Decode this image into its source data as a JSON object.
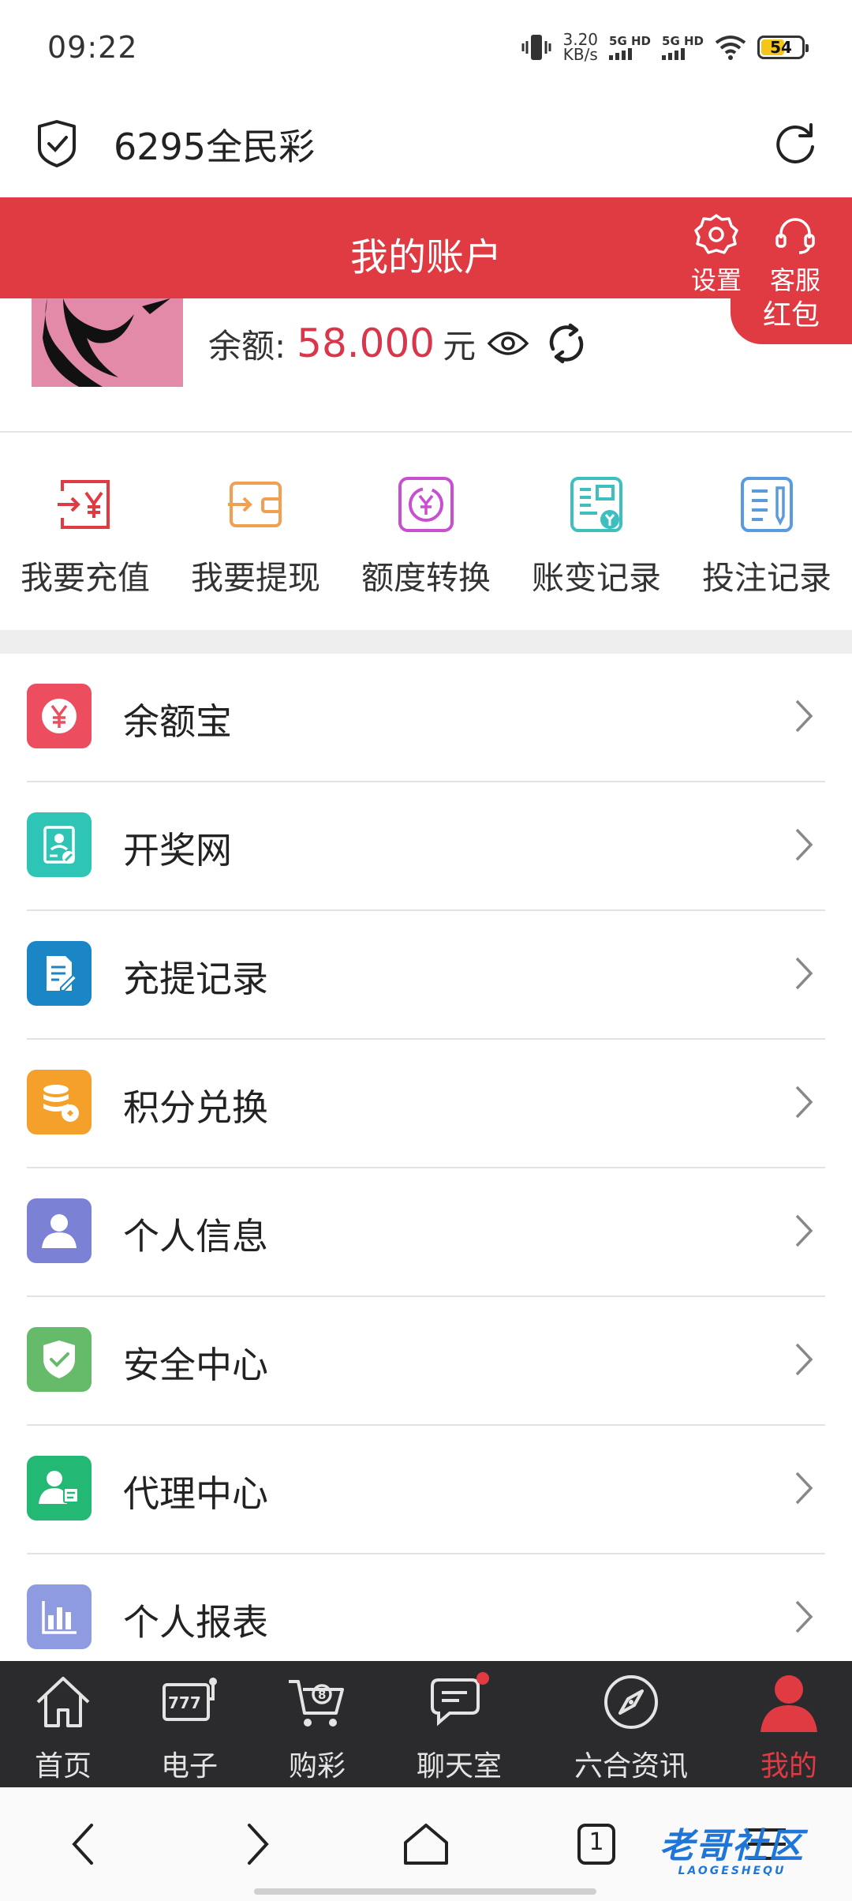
{
  "status_bar": {
    "time": "09:22",
    "net_speed_value": "3.20",
    "net_speed_unit": "KB/s",
    "sim1_label": "5G HD",
    "sim2_label": "5G HD",
    "battery": "54"
  },
  "browser": {
    "site_title": "6295全民彩",
    "left_icon": "shield-check-icon",
    "right_icon": "reload-icon"
  },
  "header": {
    "title": "我的账户",
    "settings_label": "设置",
    "service_label": "客服",
    "red_packet_label": "红包"
  },
  "profile": {
    "balance_label": "余额:",
    "balance_value": "58.000",
    "balance_unit": "元"
  },
  "quick_actions": [
    {
      "label": "我要充值",
      "icon": "recharge-icon",
      "color": "#e03a43"
    },
    {
      "label": "我要提现",
      "icon": "withdraw-icon",
      "color": "#f0a050"
    },
    {
      "label": "额度转换",
      "icon": "transfer-icon",
      "color": "#c84fd0"
    },
    {
      "label": "账变记录",
      "icon": "account-record-icon",
      "color": "#3dbfbf"
    },
    {
      "label": "投注记录",
      "icon": "bet-record-icon",
      "color": "#5a9be0"
    }
  ],
  "menu": [
    {
      "label": "余额宝",
      "icon": "yen-coin-icon",
      "color": "#ec4d5f"
    },
    {
      "label": "开奖网",
      "icon": "lottery-result-icon",
      "color": "#2ec4b6"
    },
    {
      "label": "充提记录",
      "icon": "document-edit-icon",
      "color": "#1b86c6"
    },
    {
      "label": "积分兑换",
      "icon": "coins-stack-icon",
      "color": "#f5a02a"
    },
    {
      "label": "个人信息",
      "icon": "person-icon",
      "color": "#7b82d6"
    },
    {
      "label": "安全中心",
      "icon": "shield-check-icon",
      "color": "#66bb6a"
    },
    {
      "label": "代理中心",
      "icon": "agent-icon",
      "color": "#23b874"
    },
    {
      "label": "个人报表",
      "icon": "bar-chart-icon",
      "color": "#8e9be0"
    }
  ],
  "tabs": [
    {
      "label": "首页",
      "icon": "home-icon"
    },
    {
      "label": "电子",
      "icon": "slot-machine-icon"
    },
    {
      "label": "购彩",
      "icon": "shopping-cart-icon"
    },
    {
      "label": "聊天室",
      "icon": "chat-icon"
    },
    {
      "label": "六合资讯",
      "icon": "compass-icon"
    },
    {
      "label": "我的",
      "icon": "user-icon"
    }
  ],
  "system_nav": {
    "tabs_count": "1",
    "watermark": "老哥社区",
    "watermark_sub": "LAOGESHEQU"
  },
  "colors": {
    "accent": "#e03a43",
    "balance": "#d9364b",
    "tabbar_bg": "#2b2b2d"
  }
}
